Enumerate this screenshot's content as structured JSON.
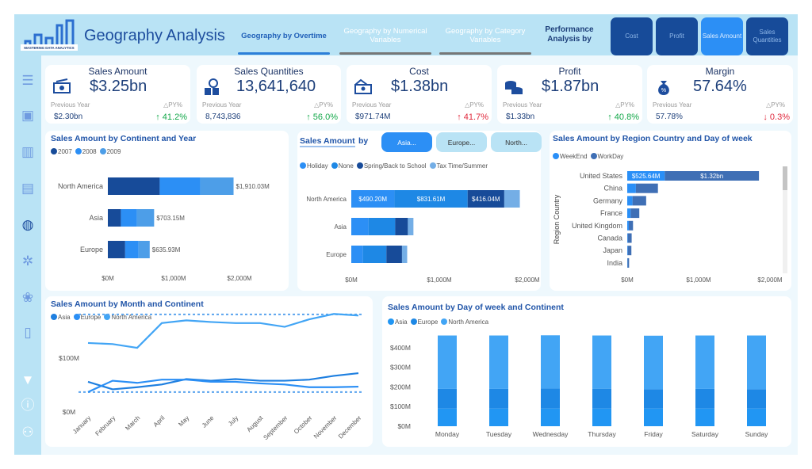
{
  "header": {
    "title": "Geography Analysis",
    "logo_text": "MASTERING DATA ANALYTICS",
    "tabs": [
      {
        "label": "Geography by Overtime",
        "active": true
      },
      {
        "label": "Geography by Numerical Variables",
        "active": false
      },
      {
        "label": "Geography by Category Variables",
        "active": false
      }
    ],
    "performance_label": "Performance Analysis by",
    "performance_buttons": [
      {
        "label": "Cost",
        "active": false
      },
      {
        "label": "Profit",
        "active": false
      },
      {
        "label": "Sales Amount",
        "active": true
      },
      {
        "label": "Sales Quantities",
        "active": false
      }
    ]
  },
  "sidebar": {
    "icons": [
      "menu-icon",
      "presentation-icon",
      "bar-chart-icon",
      "store-icon",
      "globe-icon",
      "network-icon",
      "circles-icon",
      "clipboard-icon",
      "filter-icon",
      "info-icon",
      "users-icon"
    ]
  },
  "kpis": [
    {
      "title": "Sales Amount",
      "value": "$3.25bn",
      "py_label": "Previous Year",
      "dpy_label": "△PY%",
      "py_value": "$2.30bn",
      "change": "↑ 41.2%",
      "direction": "up",
      "icon": "money-icon"
    },
    {
      "title": "Sales Quantities",
      "value": "13,641,640",
      "py_label": "Previous Year",
      "dpy_label": "△PY%",
      "py_value": "8,743,836",
      "change": "↑ 56.0%",
      "direction": "up",
      "icon": "boxes-search-icon"
    },
    {
      "title": "Cost",
      "value": "$1.38bn",
      "py_label": "Previous Year",
      "dpy_label": "△PY%",
      "py_value": "$971.74M",
      "change": "↑ 41.7%",
      "direction": "down",
      "icon": "cash-icon"
    },
    {
      "title": "Profit",
      "value": "$1.87bn",
      "py_label": "Previous Year",
      "dpy_label": "△PY%",
      "py_value": "$1.33bn",
      "change": "↑ 40.8%",
      "direction": "up",
      "icon": "coins-icon"
    },
    {
      "title": "Margin",
      "value": "57.64%",
      "py_label": "Previous Year",
      "dpy_label": "△PY%",
      "py_value": "57.78%",
      "change": "↓ 0.3%",
      "direction": "down",
      "icon": "money-bag-percent-icon"
    }
  ],
  "season_chart": {
    "title_a": "Sales Amount",
    "title_b": "by",
    "chips": [
      {
        "label": "Asia...",
        "active": true
      },
      {
        "label": "Europe...",
        "active": false
      },
      {
        "label": "North...",
        "active": false
      }
    ]
  },
  "colors": {
    "accent": "#2c8ff5",
    "dark": "#174b99",
    "title": "#2155a8",
    "header_bg": "#b9e3f5"
  },
  "chart_data": [
    {
      "id": "continent_year",
      "type": "bar",
      "orientation": "horizontal",
      "stacked": true,
      "title": "Sales Amount by Continent and Year",
      "categories": [
        "North America",
        "Asia",
        "Europe"
      ],
      "series": [
        {
          "name": "2007",
          "values": [
            788,
            198,
            263
          ],
          "color": "#174b99"
        },
        {
          "name": "2008",
          "values": [
            615,
            243,
            204
          ],
          "color": "#2c8ff5"
        },
        {
          "name": "2009",
          "values": [
            507,
            262,
            169
          ],
          "color": "#4d9ee8"
        }
      ],
      "total_labels": [
        "$1,910.03M",
        "$703.15M",
        "$635.93M"
      ],
      "xticks": [
        "$0M",
        "$1,000M",
        "$2,000M"
      ],
      "xlim": [
        0,
        2000
      ]
    },
    {
      "id": "season",
      "type": "bar",
      "orientation": "horizontal",
      "stacked": true,
      "categories": [
        "North America",
        "Asia",
        "Europe"
      ],
      "series": [
        {
          "name": "Holiday",
          "values": [
            490.2,
            196,
            133
          ],
          "color": "#2c8ff5",
          "labels": [
            "$490.20M",
            "",
            ""
          ]
        },
        {
          "name": "None",
          "values": [
            831.61,
            303,
            266
          ],
          "color": "#1e88e5",
          "labels": [
            "$831.61M",
            "",
            ""
          ]
        },
        {
          "name": "Spring/Back to School",
          "values": [
            416.04,
            144,
            177
          ],
          "color": "#174b99",
          "labels": [
            "$416.04M",
            "",
            ""
          ]
        },
        {
          "name": "Tax Time/Summer",
          "values": [
            177,
            63,
            59
          ],
          "color": "#74aee6",
          "labels": [
            "",
            "",
            ""
          ]
        }
      ],
      "xticks": [
        "$0M",
        "$1,000M",
        "$2,000M"
      ],
      "xlim": [
        0,
        2000
      ]
    },
    {
      "id": "region_country",
      "type": "bar",
      "orientation": "horizontal",
      "stacked": true,
      "title": "Sales Amount by Region Country and Day of week",
      "ylabel": "Region Country",
      "categories": [
        "United States",
        "China",
        "Germany",
        "France",
        "United Kingdom",
        "Canada",
        "Japan",
        "India"
      ],
      "series": [
        {
          "name": "WeekEnd",
          "values": [
            525.64,
            121,
            74,
            48,
            22,
            7,
            7,
            4
          ],
          "color": "#2a8ff7",
          "labels": [
            "$525.64M",
            "",
            "",
            "",
            "",
            "",
            "",
            ""
          ]
        },
        {
          "name": "WorkDay",
          "values": [
            1320,
            309,
            191,
            121,
            59,
            55,
            51,
            22
          ],
          "color": "#3f6fb5",
          "labels": [
            "$1.32bn",
            "",
            "",
            "",
            "",
            "",
            "",
            ""
          ]
        }
      ],
      "xticks": [
        "$0M",
        "$1,000M",
        "$2,000M"
      ],
      "xlim": [
        0,
        2000
      ]
    },
    {
      "id": "month_continent",
      "type": "line",
      "title": "Sales Amount by Month and Continent",
      "categories": [
        "January",
        "February",
        "March",
        "April",
        "May",
        "June",
        "July",
        "August",
        "September",
        "October",
        "November",
        "December"
      ],
      "series": [
        {
          "name": "Asia",
          "values": [
            56,
            42,
            46,
            51,
            61,
            58,
            61,
            58,
            58,
            60,
            67,
            72
          ],
          "color": "#1e7fe0"
        },
        {
          "name": "Europe",
          "values": [
            37,
            58,
            54,
            60,
            60,
            56,
            56,
            53,
            51,
            46,
            46,
            47
          ],
          "color": "#2b8ff5"
        },
        {
          "name": "North America",
          "values": [
            128,
            126,
            119,
            165,
            170,
            167,
            165,
            165,
            158,
            172,
            182,
            179
          ],
          "color": "#42a5f5"
        }
      ],
      "reference_lines": [
        181,
        37
      ],
      "yticks": [
        "$0M",
        "$100M"
      ],
      "ylim": [
        0,
        200
      ]
    },
    {
      "id": "day_continent",
      "type": "bar",
      "orientation": "vertical",
      "stacked": true,
      "title": "Sales Amount by Day of week and Continent",
      "categories": [
        "Monday",
        "Tuesday",
        "Wednesday",
        "Thursday",
        "Friday",
        "Saturday",
        "Sunday"
      ],
      "series": [
        {
          "name": "Asia",
          "values": [
            90,
            90,
            90,
            90,
            90,
            90,
            90
          ],
          "color": "#2196f3"
        },
        {
          "name": "Europe",
          "values": [
            100,
            100,
            102,
            101,
            98,
            100,
            98
          ],
          "color": "#1e88e5"
        },
        {
          "name": "North America",
          "values": [
            272,
            272,
            271,
            271,
            273,
            272,
            274
          ],
          "color": "#42a5f5"
        }
      ],
      "yticks": [
        "$0M",
        "$100M",
        "$200M",
        "$300M",
        "$400M"
      ],
      "ylim": [
        0,
        460
      ]
    }
  ]
}
